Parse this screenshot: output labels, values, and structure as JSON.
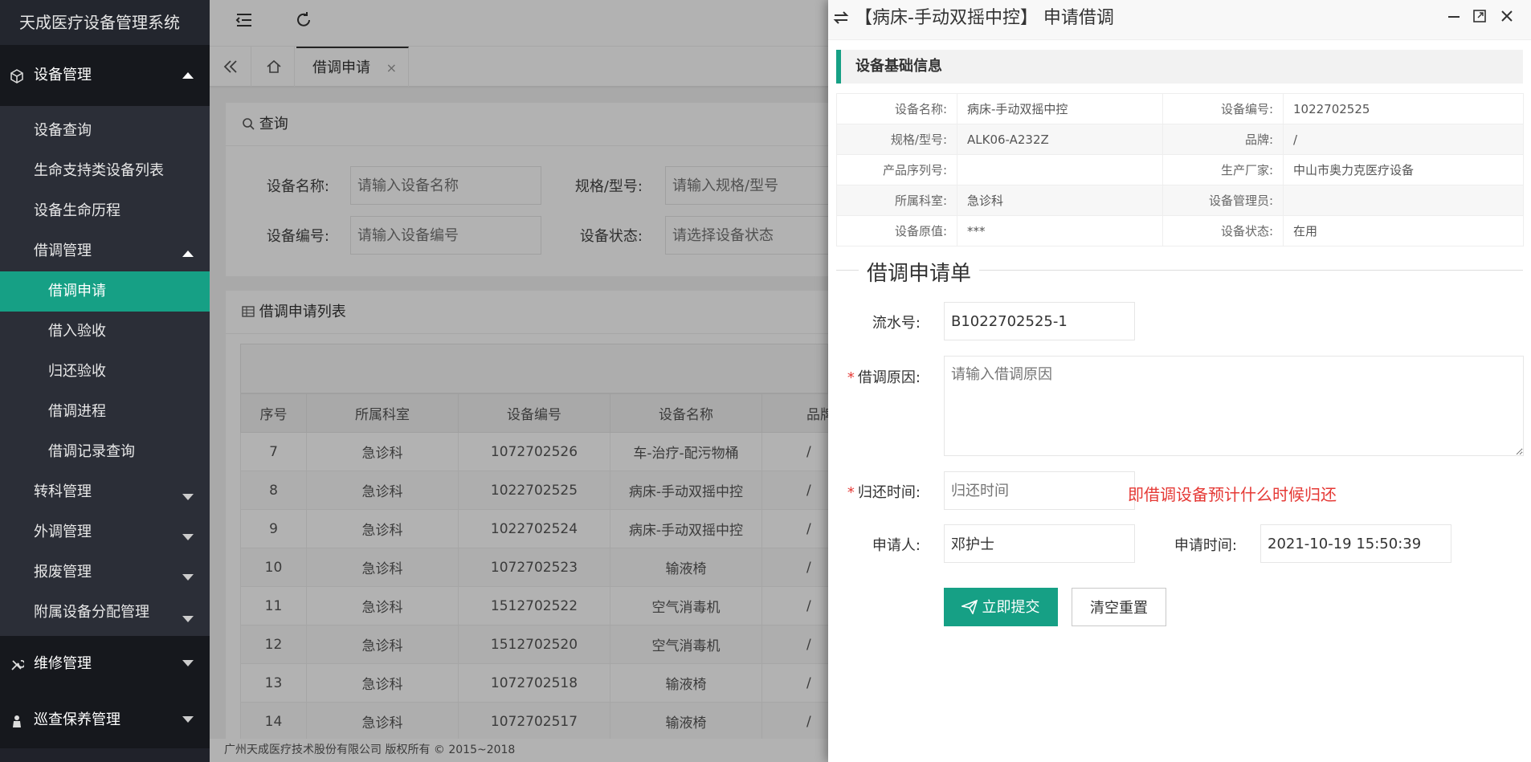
{
  "app_title": "天成医疗设备管理系统",
  "sidebar": {
    "group_equipment": "设备管理",
    "items": [
      {
        "label": "设备查询"
      },
      {
        "label": "生命支持类设备列表"
      },
      {
        "label": "设备生命历程"
      },
      {
        "label": "借调管理"
      }
    ],
    "borrow_items": [
      {
        "label": "借调申请"
      },
      {
        "label": "借入验收"
      },
      {
        "label": "归还验收"
      },
      {
        "label": "借调进程"
      },
      {
        "label": "借调记录查询"
      }
    ],
    "more_items": [
      {
        "label": "转科管理"
      },
      {
        "label": "外调管理"
      },
      {
        "label": "报废管理"
      },
      {
        "label": "附属设备分配管理"
      }
    ],
    "group_repair": "维修管理",
    "group_patrol": "巡查保养管理"
  },
  "tabs": {
    "active_label": "借调申请",
    "close": "×"
  },
  "search": {
    "title": "查询",
    "name_label": "设备名称:",
    "name_placeholder": "请输入设备名称",
    "spec_label": "规格/型号:",
    "spec_placeholder": "请输入规格/型号",
    "code_label": "设备编号:",
    "code_placeholder": "请输入设备编号",
    "status_label": "设备状态:",
    "status_placeholder": "请选择设备状态"
  },
  "list": {
    "title": "借调申请列表",
    "columns": [
      "序号",
      "所属科室",
      "设备编号",
      "设备名称",
      "品牌"
    ],
    "rows": [
      [
        "7",
        "急诊科",
        "1072702526",
        "车-治疗-配污物桶",
        "/"
      ],
      [
        "8",
        "急诊科",
        "1022702525",
        "病床-手动双摇中控",
        "/"
      ],
      [
        "9",
        "急诊科",
        "1022702524",
        "病床-手动双摇中控",
        "/"
      ],
      [
        "10",
        "急诊科",
        "1072702523",
        "输液椅",
        "/"
      ],
      [
        "11",
        "急诊科",
        "1512702522",
        "空气消毒机",
        "/"
      ],
      [
        "12",
        "急诊科",
        "1512702520",
        "空气消毒机",
        "/"
      ],
      [
        "13",
        "急诊科",
        "1072702518",
        "输液椅",
        "/"
      ],
      [
        "14",
        "急诊科",
        "1072702517",
        "输液椅",
        "/"
      ]
    ]
  },
  "footer": "广州天成医疗技术股份有限公司 版权所有 © 2015~2018",
  "dialog": {
    "title": "【病床-手动双摇中控】 申请借调",
    "info_title": "设备基础信息",
    "info": [
      [
        "设备名称:",
        "病床-手动双摇中控",
        "设备编号:",
        "1022702525"
      ],
      [
        "规格/型号:",
        "ALK06-A232Z",
        "品牌:",
        "/"
      ],
      [
        "产品序列号:",
        "",
        "生产厂家:",
        "中山市奥力克医疗设备"
      ],
      [
        "所属科室:",
        "急诊科",
        "设备管理员:",
        ""
      ],
      [
        "设备原值:",
        "***",
        "设备状态:",
        "在用"
      ]
    ],
    "form_title": "借调申请单",
    "serial_label": "流水号:",
    "serial_value": "B1022702525-1",
    "reason_label": "借调原因:",
    "reason_placeholder": "请输入借调原因",
    "return_label": "归还时间:",
    "return_placeholder": "归还时间",
    "return_note": "即借调设备预计什么时候归还",
    "applicant_label": "申请人:",
    "applicant_value": "邓护士",
    "apply_time_label": "申请时间:",
    "apply_time_value": "2021-10-19 15:50:39",
    "submit_label": "立即提交",
    "reset_label": "清空重置"
  },
  "colors": {
    "accent": "#16a085",
    "sidebar_bg": "#20222a",
    "required": "#e53935"
  }
}
